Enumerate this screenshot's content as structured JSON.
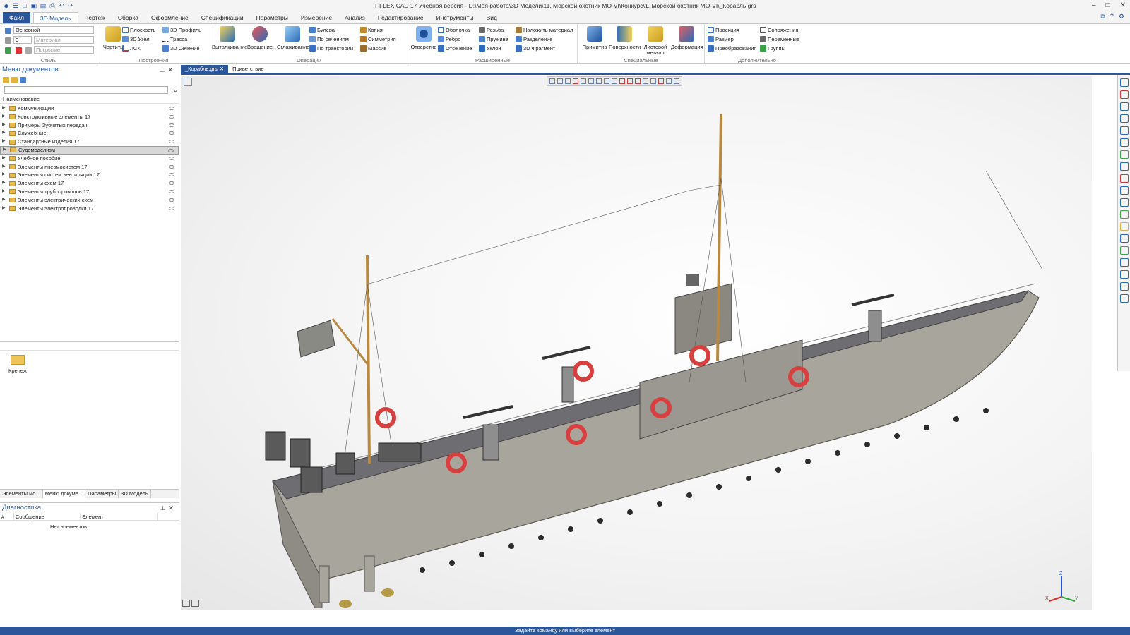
{
  "window": {
    "title": "T-FLEX CAD 17 Учебная версия - D:\\Моя работа\\3D Модели\\11. Морской охотник МО-VI\\Конкурс\\1. Морской охотник МО-VI\\_Корабль.grs"
  },
  "menu": {
    "items": [
      "Файл",
      "3D Модель",
      "Чертёж",
      "Сборка",
      "Оформление",
      "Спецификации",
      "Параметры",
      "Измерение",
      "Анализ",
      "Редактирование",
      "Инструменты",
      "Вид"
    ]
  },
  "ribbon": {
    "style": {
      "label": "Стиль",
      "layer": "Основной",
      "level": "0",
      "material_placeholder": "Материал",
      "coating_placeholder": "Покрытие"
    },
    "build": {
      "label": "Построения",
      "draw": "Чертить",
      "plane": "Плоскость",
      "node3d": "3D Узел",
      "lsk": "ЛСК",
      "profile3d": "3D Профиль",
      "path": "Трасса",
      "section3d": "3D Сечение"
    },
    "ops": {
      "label": "Операции",
      "extrude": "Выталкивание",
      "revolve": "Вращение",
      "smooth": "Сглаживание",
      "boolean": "Булева",
      "by_sections": "По сечениям",
      "by_path": "По траектории",
      "copy": "Копия",
      "symmetry": "Симметрия",
      "array": "Массив"
    },
    "ext": {
      "label": "Расширенные",
      "hole": "Отверстие",
      "shell": "Оболочка",
      "rib": "Ребро",
      "cut": "Отсечение",
      "thread": "Резьба",
      "spring": "Пружина",
      "draft": "Уклон",
      "apply_material": "Наложить материал",
      "split": "Разделение",
      "fragment3d": "3D Фрагмент"
    },
    "special": {
      "label": "Специальные",
      "primitive": "Примитив",
      "surfaces": "Поверхности",
      "sheet_metal": "Листовой металл",
      "deformation": "Деформация"
    },
    "extra": {
      "label": "Дополнительно",
      "projection": "Проекция",
      "size": "Размер",
      "transforms": "Преобразования",
      "mates": "Сопряжения",
      "variables": "Переменные",
      "groups": "Группы"
    }
  },
  "docmenu": {
    "title": "Меню документов",
    "column": "Наименование",
    "items": [
      "Коммуникации",
      "Конструктивные элементы 17",
      "Примеры Зубчатых передач",
      "Служебные",
      "Стандартные изделия 17",
      "Судомоделизм",
      "Учебное пособие",
      "Элементы пневмосистем 17",
      "Элементы систем вентиляции 17",
      "Элементы схем 17",
      "Элементы трубопроводов 17",
      "Элементы электрических схем",
      "Элементы электропроводки 17"
    ],
    "preview_item": "Крепеж"
  },
  "lefttabs": [
    "Элементы мо...",
    "Меню докуме...",
    "Параметры",
    "3D Модель"
  ],
  "diagnostics": {
    "title": "Диагностика",
    "col_num": "#",
    "col_msg": "Сообщение",
    "col_elem": "Элемент",
    "empty": "Нет элементов"
  },
  "doctabs": [
    "_Корабль.grs",
    "Приветствие"
  ],
  "status": {
    "text": "Задайте команду или выберите элемент"
  },
  "triad": {
    "x": "X",
    "y": "Y",
    "z": "Z"
  }
}
